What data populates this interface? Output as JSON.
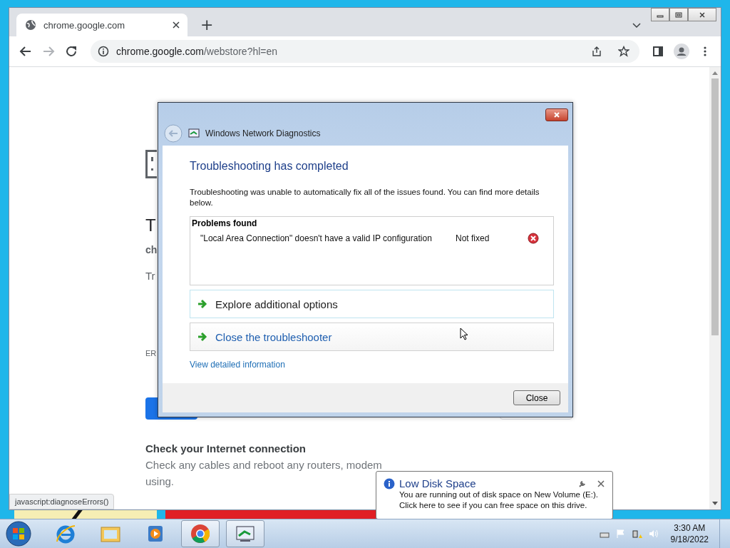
{
  "browser": {
    "tabs": [
      {
        "title": "chrome.google.com",
        "selected": true
      }
    ],
    "new_tab": "+",
    "address": {
      "host": "chrome.google.com",
      "path": "/webstore?hl=en"
    },
    "page": {
      "heading": "T",
      "subheading": "ch",
      "hint": "Tr",
      "error_code": "ER",
      "section_title": "Check your Internet connection",
      "section_lines": [
        "Check any cables and reboot any routers, modem",
        "using."
      ]
    },
    "status_url": "javascript:diagnoseErrors()"
  },
  "dialog": {
    "title": "Windows Network Diagnostics",
    "heading": "Troubleshooting has completed",
    "message": "Troubleshooting was unable to automatically fix all of the issues found. You can find more details below.",
    "problems_header": "Problems found",
    "problems": [
      {
        "description": "\"Local Area Connection\" doesn't have a valid IP configuration",
        "status": "Not fixed",
        "fixed": false
      }
    ],
    "options": [
      {
        "label": "Explore additional options",
        "focused": true
      },
      {
        "label": "Close the troubleshooter",
        "focused": false
      }
    ],
    "link": "View detailed information",
    "button": "Close"
  },
  "notification": {
    "title": "Low Disk Space",
    "lines": [
      "You are running out of disk space on New Volume (E:).",
      "Click here to see if you can free space on this drive."
    ]
  },
  "taskbar": {
    "apps": [
      {
        "kind": "ie",
        "running": false
      },
      {
        "kind": "explorer",
        "running": false
      },
      {
        "kind": "media",
        "running": false
      },
      {
        "kind": "chrome",
        "running": true
      },
      {
        "kind": "network",
        "running": true
      }
    ],
    "clock": {
      "time": "3:30 AM",
      "date": "9/18/2022"
    }
  }
}
